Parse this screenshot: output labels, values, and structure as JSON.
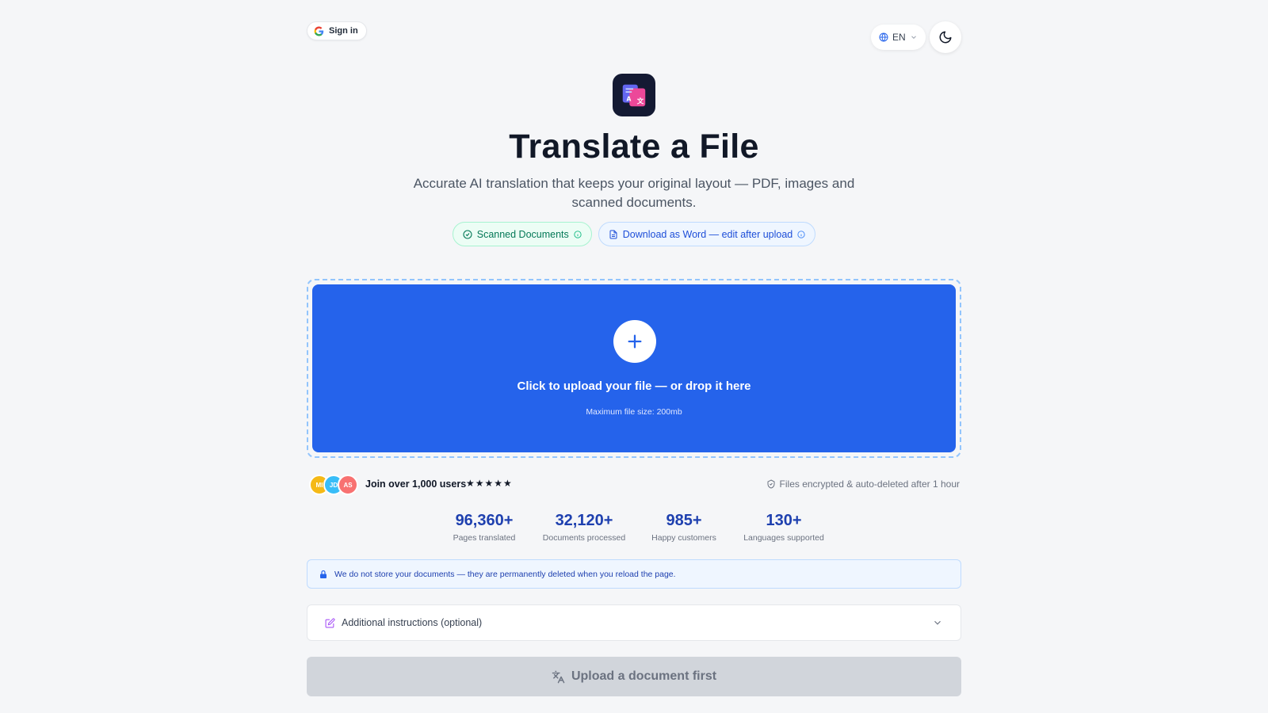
{
  "header": {
    "signin_label": "Sign in",
    "language": "EN"
  },
  "hero": {
    "title": "Translate a File",
    "subtitle": "Accurate AI translation that keeps your original layout — PDF, images and scanned documents.",
    "chips": [
      {
        "label": "Scanned Documents"
      },
      {
        "label": "Download as Word — edit after upload"
      }
    ]
  },
  "upload": {
    "label": "Click to upload your file — or drop it here",
    "hint": "Maximum file size: 200mb"
  },
  "social": {
    "avatars": [
      {
        "initials": "MI",
        "color": "#f5b916"
      },
      {
        "initials": "JD",
        "color": "#38bdf8"
      },
      {
        "initials": "AS",
        "color": "#f87171"
      }
    ],
    "join_text": "Join over 1,000 users",
    "stars": "★★★★★",
    "security_text": "Files encrypted & auto-deleted after 1 hour"
  },
  "stats": [
    {
      "value": "96,360+",
      "label": "Pages translated"
    },
    {
      "value": "32,120+",
      "label": "Documents processed"
    },
    {
      "value": "985+",
      "label": "Happy customers"
    },
    {
      "value": "130+",
      "label": "Languages supported"
    }
  ],
  "notice": {
    "text": "We do not store your documents — they are permanently deleted when you reload the page."
  },
  "instructions": {
    "label": "Additional instructions (optional)"
  },
  "submit": {
    "label": "Upload a document first"
  },
  "colors": {
    "accent": "#2563eb",
    "stat_text": "#1e40af",
    "disabled": "#d1d5db"
  }
}
